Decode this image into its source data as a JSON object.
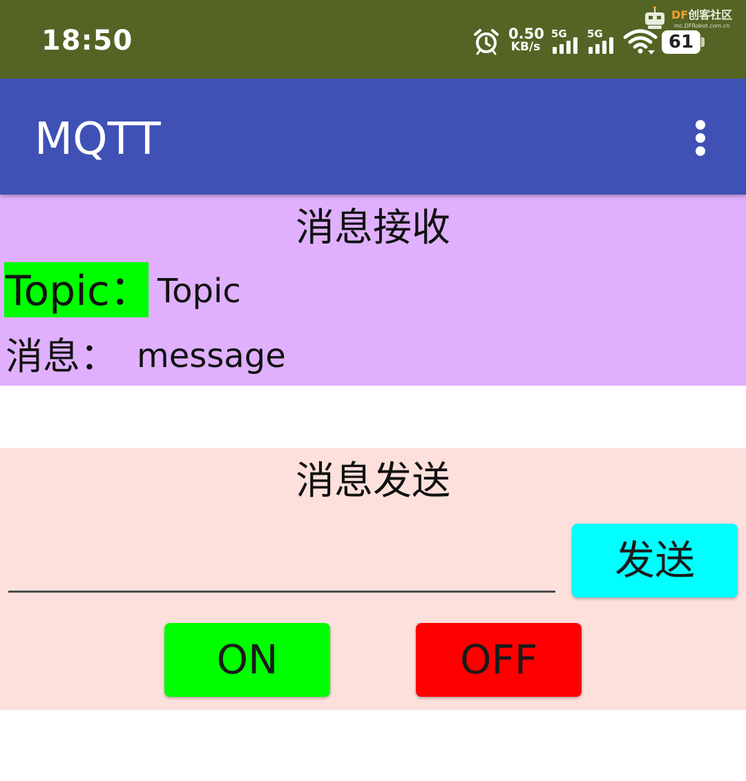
{
  "status_bar": {
    "time": "18:50",
    "net_speed_value": "0.50",
    "net_speed_unit": "KB/s",
    "signal_1_label": "5G",
    "signal_2_label": "5G",
    "battery_level": "61",
    "icons": [
      "alarm-icon",
      "signal-icon",
      "wifi-icon",
      "battery-icon"
    ]
  },
  "watermark": {
    "brand_prefix": "DF",
    "brand_suffix": "创客社区",
    "url": "mc.DFRobot.com.cn"
  },
  "app_bar": {
    "title": "MQTT",
    "menu_icon": "more-vert-icon"
  },
  "receive": {
    "heading": "消息接收",
    "topic_label": "Topic：",
    "topic_value": "Topic",
    "message_label": "消息：",
    "message_value": "message"
  },
  "send": {
    "heading": "消息发送",
    "input_value": "",
    "send_label": "发送",
    "on_label": "ON",
    "off_label": "OFF"
  },
  "colors": {
    "status_bar": "#546424",
    "app_bar": "#3f51b5",
    "receive_bg": "#e0b0fe",
    "send_bg": "#fde0dc",
    "topic_highlight": "#00ff00",
    "send_button": "#00ffff",
    "on_button": "#00ff00",
    "off_button": "#ff0000"
  }
}
